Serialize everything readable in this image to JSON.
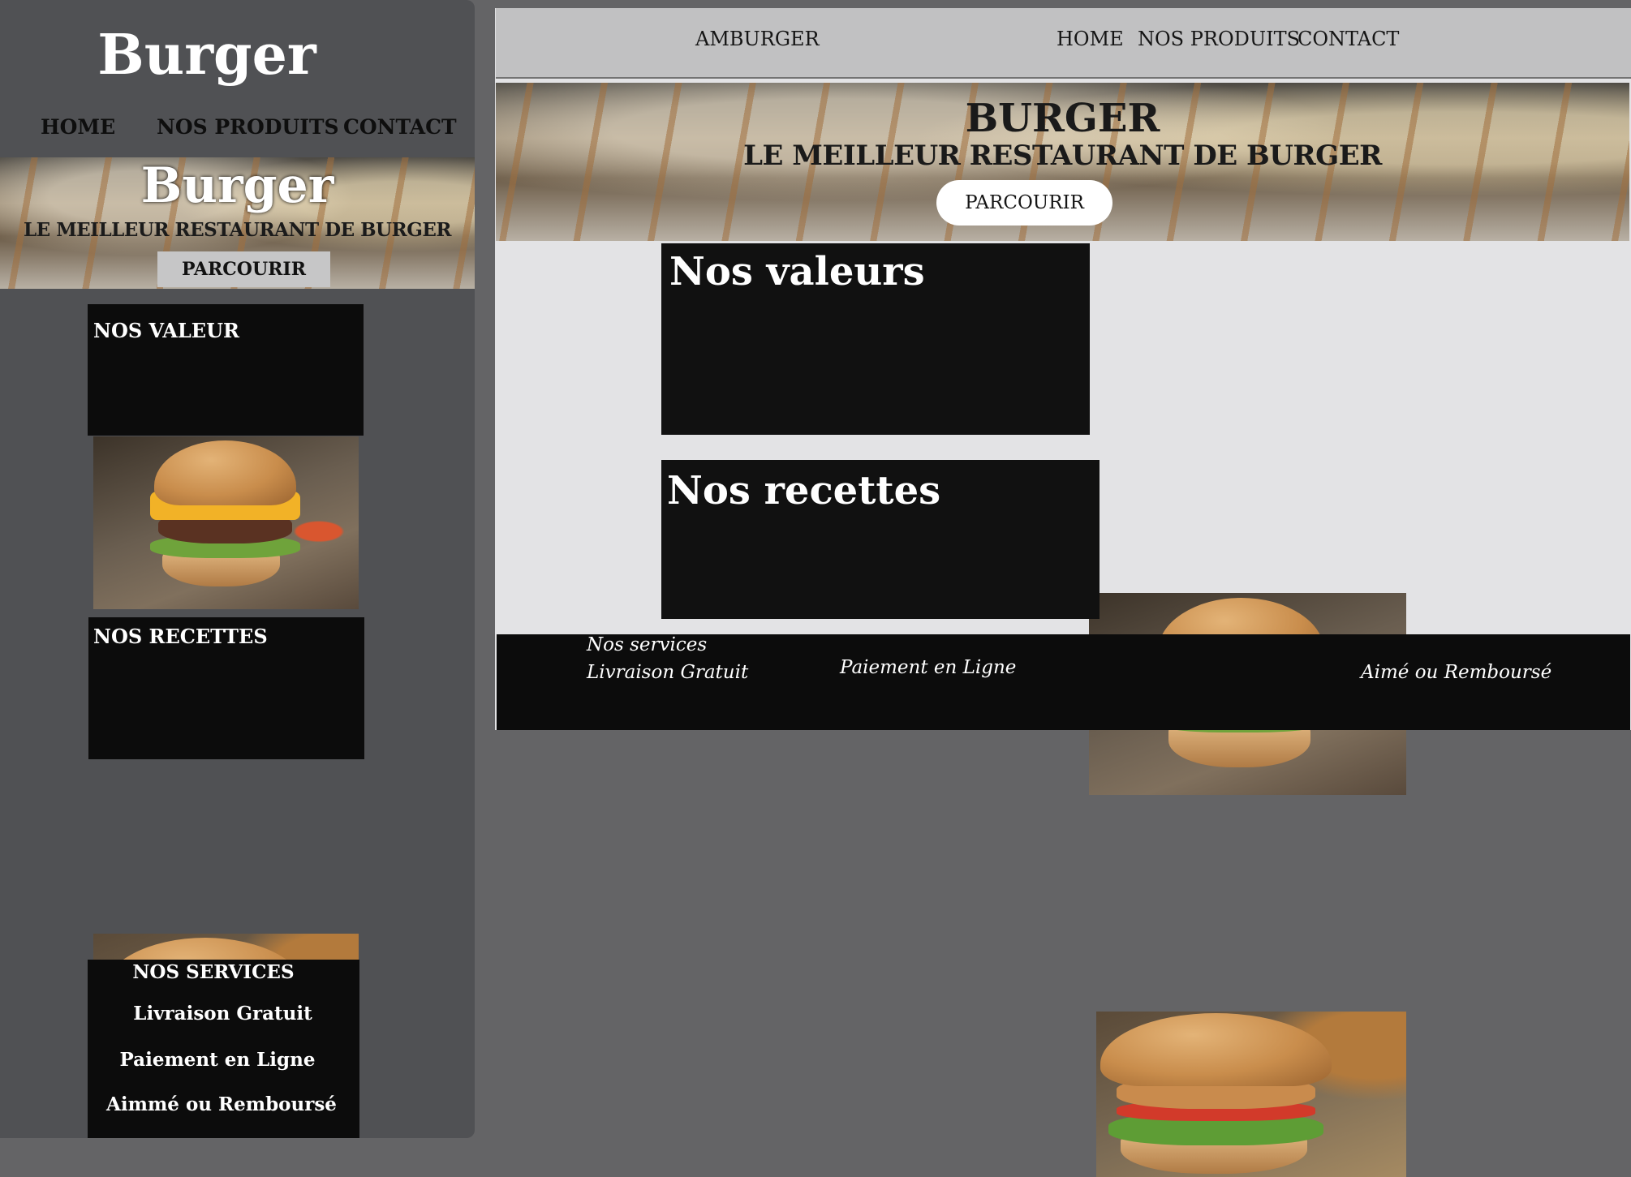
{
  "mobile": {
    "title": "Burger",
    "nav": [
      "HOME",
      "NOS PRODUITS",
      "CONTACT"
    ],
    "hero": {
      "title": "Burger",
      "subtitle": "LE MEILLEUR RESTAURANT DE BURGER",
      "button": "PARCOURIR"
    },
    "sections": [
      {
        "title": "NOS VALEUR"
      },
      {
        "title": "NOS RECETTES"
      }
    ],
    "services": {
      "title": "NOS SERVICES",
      "items": [
        "Livraison Gratuit",
        "Paiement en Ligne",
        "Aimmé ou Remboursé"
      ]
    }
  },
  "desktop": {
    "brand": "AMBURGER",
    "nav": [
      "HOME",
      "NOS PRODUITS",
      "CONTACT"
    ],
    "hero": {
      "title": "BURGER",
      "subtitle": "LE MEILLEUR RESTAURANT DE BURGER",
      "button": "PARCOURIR"
    },
    "sections": [
      {
        "title": "Nos valeurs"
      },
      {
        "title": "Nos recettes"
      }
    ],
    "footer": {
      "title": "Nos services",
      "items": [
        "Livraison Gratuit",
        "Paiement en Ligne",
        "Aimé ou Remboursé"
      ]
    }
  },
  "colors": {
    "background": "#646466",
    "mobile_panel": "#505154",
    "block": "#0c0c0c",
    "desktop_page": "#e3e3e5",
    "topbar": "#c1c1c2"
  }
}
